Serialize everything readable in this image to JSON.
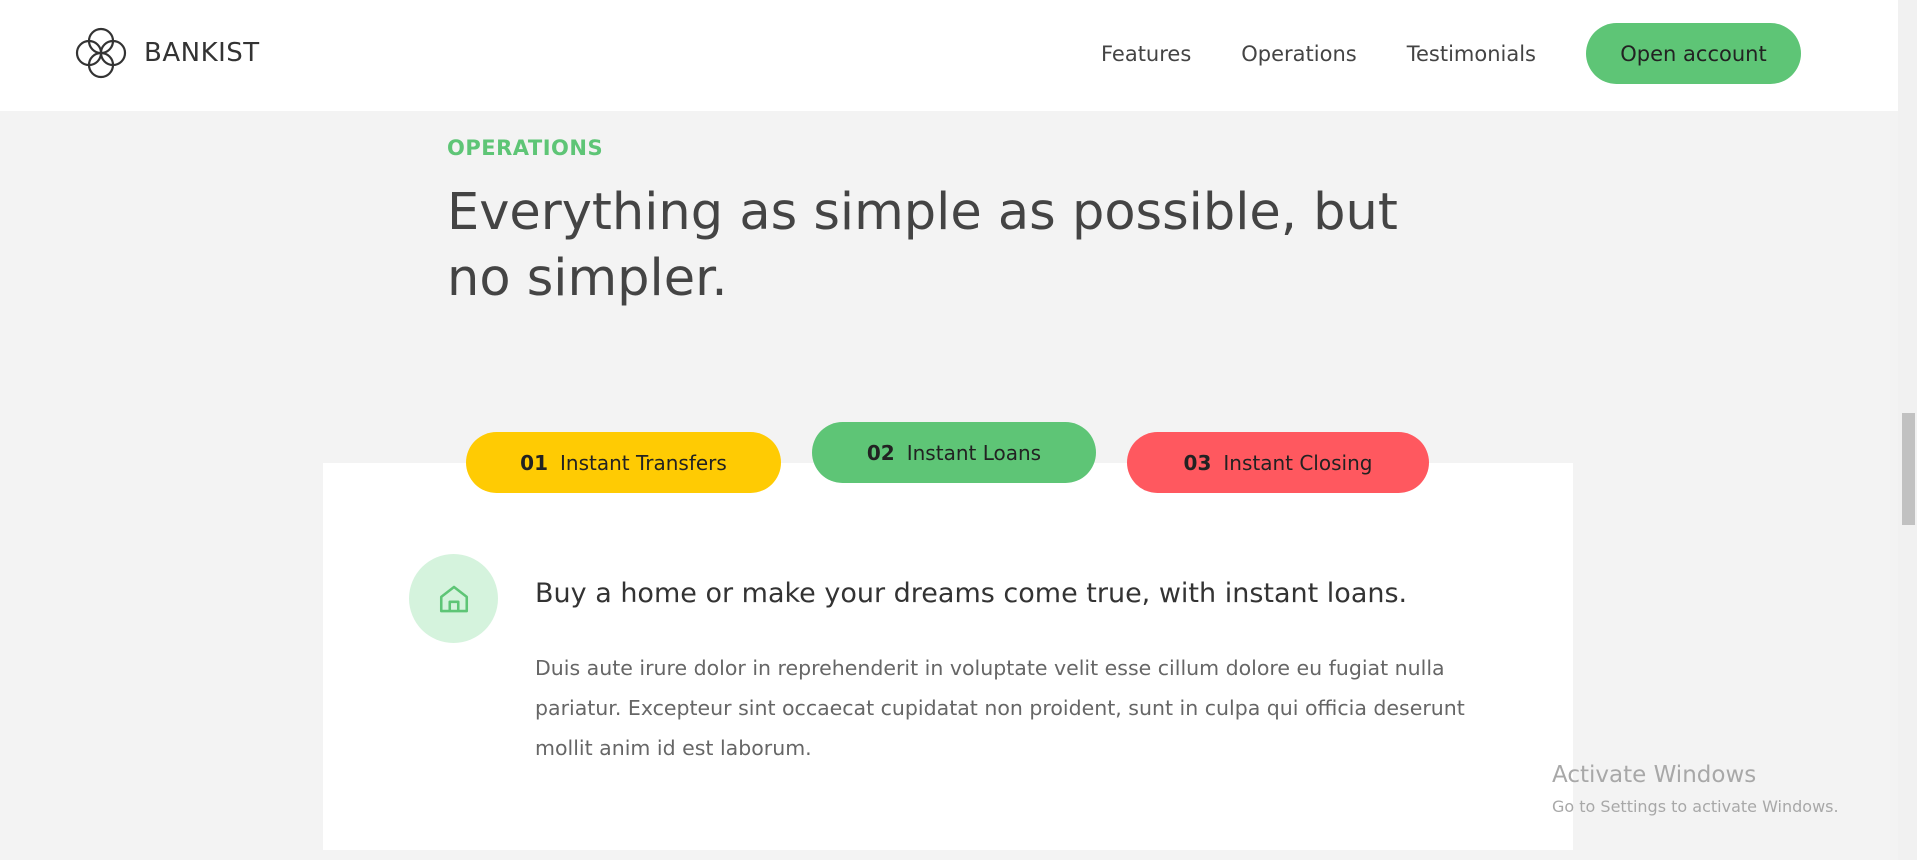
{
  "header": {
    "brand": "BANKIST",
    "nav": [
      "Features",
      "Operations",
      "Testimonials"
    ],
    "cta_label": "Open account"
  },
  "section": {
    "label": "OPERATIONS",
    "title": "Everything as simple as possible, but no simpler."
  },
  "tabs": [
    {
      "number": "01",
      "label": "Instant Transfers",
      "color": "#ffcb03"
    },
    {
      "number": "02",
      "label": "Instant Loans",
      "color": "#5ec576",
      "active": true
    },
    {
      "number": "03",
      "label": "Instant Closing",
      "color": "#ff585f"
    }
  ],
  "content": {
    "icon": "home-icon",
    "title": "Buy a home or make your dreams come true, with instant loans.",
    "text": "Duis aute irure dolor in reprehenderit in voluptate velit esse cillum dolore eu fugiat nulla pariatur. Excepteur sint occaecat cupidatat non proident, sunt in culpa qui officia deserunt mollit anim id est laborum."
  },
  "watermark": {
    "title": "Activate Windows",
    "subtitle": "Go to Settings to activate Windows."
  },
  "colors": {
    "accent_green": "#5ec576",
    "accent_yellow": "#ffcb03",
    "accent_red": "#ff585f",
    "background": "#f3f3f3"
  }
}
